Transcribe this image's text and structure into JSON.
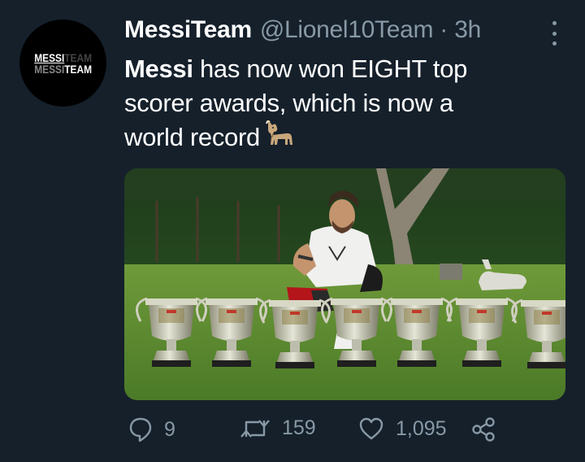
{
  "avatar": {
    "line1_a": "MESSI",
    "line1_b": "TEAM",
    "line2_a": "MESSI",
    "line2_b": "TEAM"
  },
  "header": {
    "name": "MessiTeam",
    "handle": "@Lionel10Team",
    "separator": "·",
    "time": "3h"
  },
  "tweet": {
    "bold": "Messi",
    "rest_line1": " has now won EIGHT top",
    "line2": "scorer awards, which is now a",
    "line3": "world record",
    "emoji": "goat-emoji"
  },
  "media": {
    "description_icon": "photo"
  },
  "actions": {
    "reply_count": "9",
    "retweet_count": "159",
    "like_count": "1,095"
  },
  "colors": {
    "background": "#15202b",
    "secondary_text": "#8899a6",
    "primary_text": "#ffffff"
  }
}
